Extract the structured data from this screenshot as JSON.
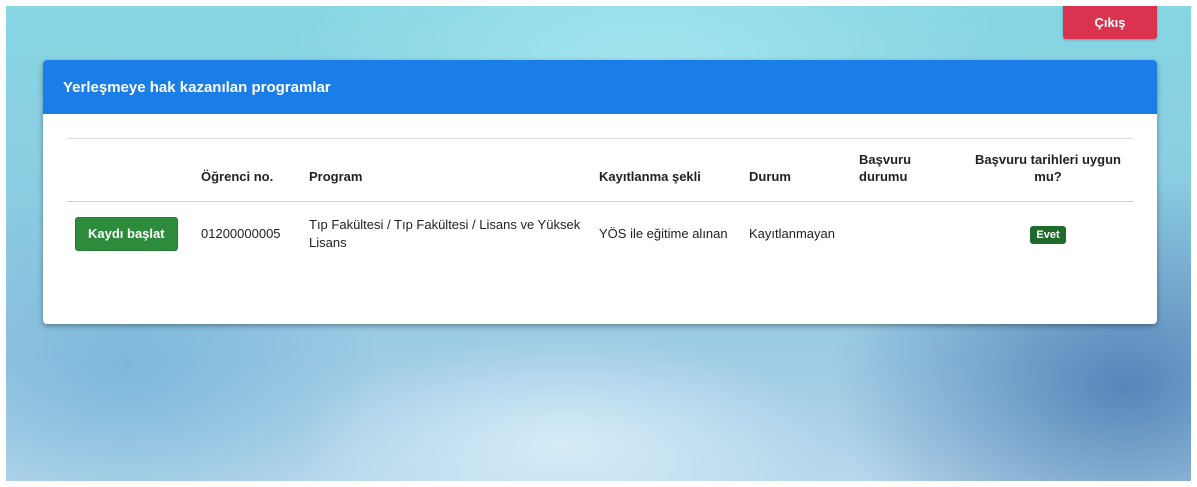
{
  "header": {
    "logout_label": "Çıkış"
  },
  "panel": {
    "title": "Yerleşmeye hak kazanılan programlar"
  },
  "table": {
    "columns": {
      "action": "",
      "student_no": "Öğrenci no.",
      "program": "Program",
      "enrollment_type": "Kayıtlanma şekli",
      "status": "Durum",
      "application_status": "Başvuru durumu",
      "dates_valid": "Başvuru tarihleri uygun mu?"
    },
    "rows": [
      {
        "action_label": "Kaydı başlat",
        "student_no": "01200000005",
        "program": "Tıp Fakültesi / Tıp Fakültesi / Lisans ve Yüksek Lisans",
        "enrollment_type": "YÖS ile eğitime alınan",
        "status": "Kayıtlanmayan",
        "application_status": "",
        "dates_valid": "Evet"
      }
    ]
  },
  "colors": {
    "header_blue": "#1a7de8",
    "logout_red": "#d9334f",
    "start_green": "#2c8c3c",
    "badge_green": "#1f6b2a"
  }
}
